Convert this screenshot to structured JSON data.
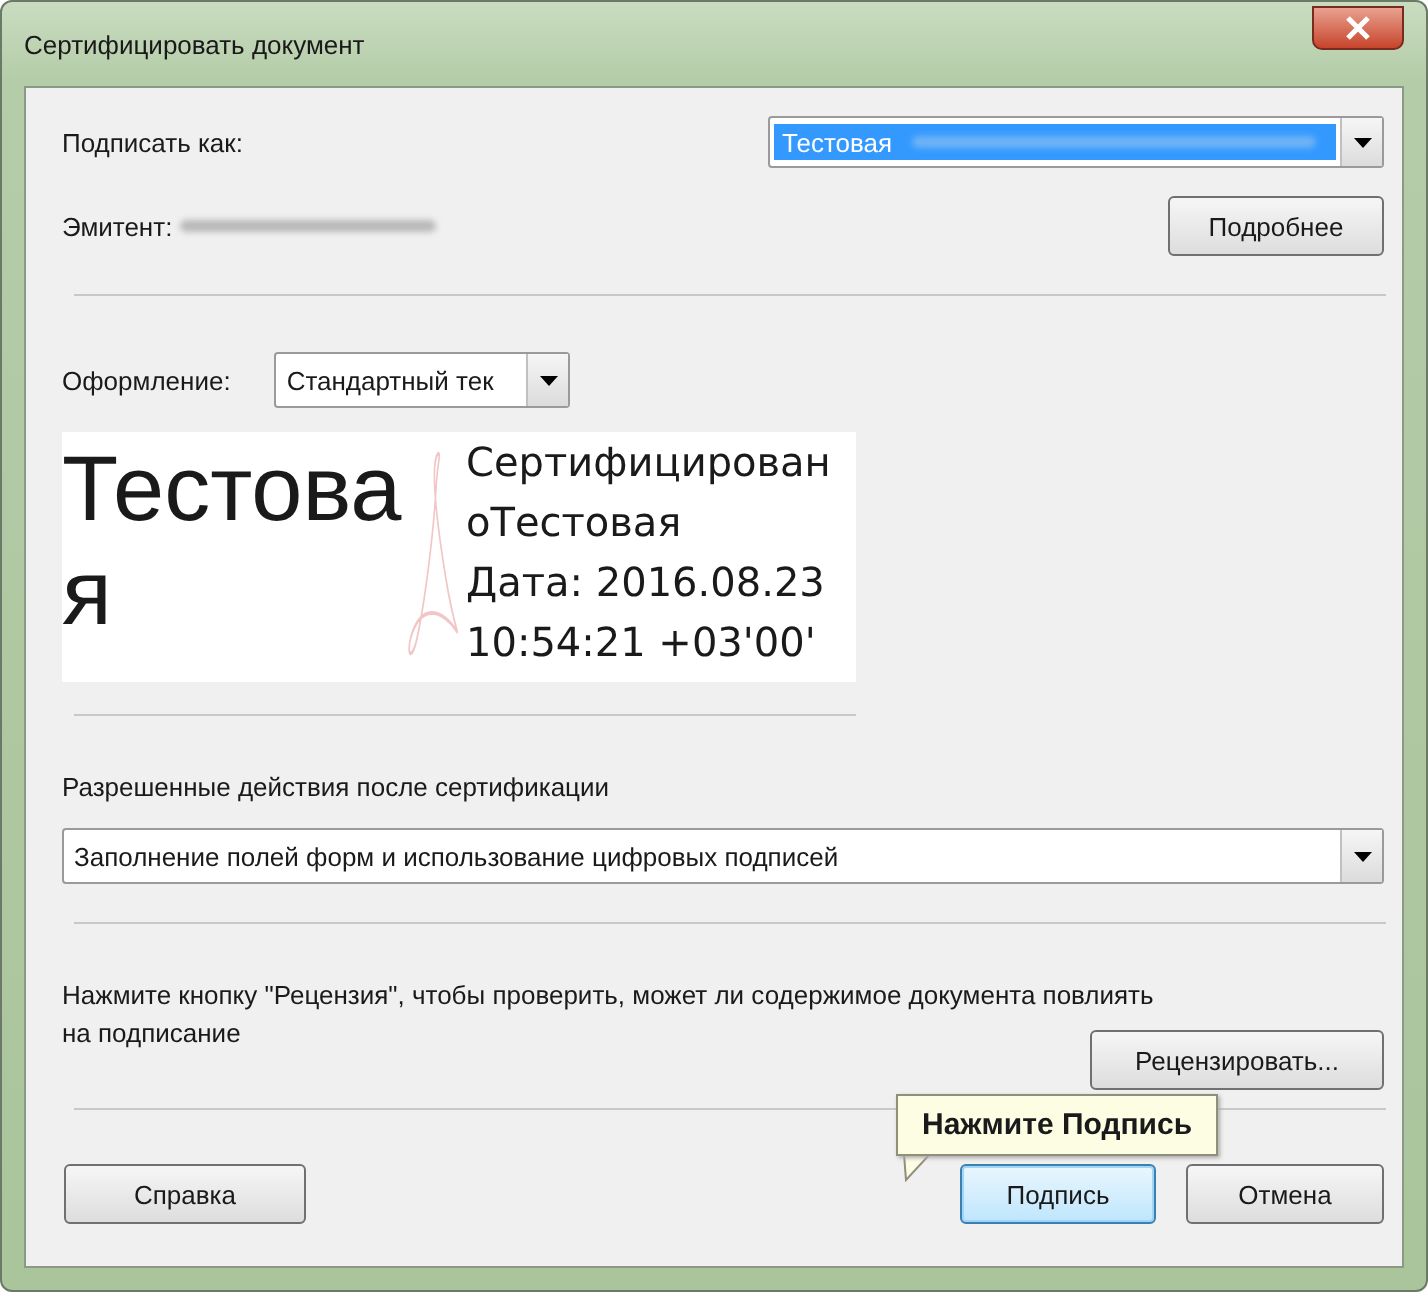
{
  "window": {
    "title": "Сертифицировать документ"
  },
  "sign_as": {
    "label": "Подписать как:",
    "value": "Тестовая"
  },
  "issuer": {
    "label": "Эмитент:"
  },
  "details_button": "Подробнее",
  "appearance": {
    "label": "Оформление:",
    "value": "Стандартный тек"
  },
  "preview": {
    "name_lines": [
      "Тестова",
      "я"
    ],
    "detail_lines": [
      "Сертифицирован",
      "оТестовая",
      "Дата: 2016.08.23",
      "10:54:21 +03'00'"
    ]
  },
  "permitted": {
    "label": "Разрешенные действия после сертификации",
    "value": "Заполнение полей форм и использование цифровых подписей"
  },
  "review": {
    "text": "Нажмите кнопку \"Рецензия\", чтобы проверить, может ли содержимое документа повлиять на подписание",
    "button": "Рецензировать..."
  },
  "tooltip": "Нажмите Подпись",
  "buttons": [
    {
      "label": "Справка",
      "selected": false
    },
    {
      "label": "Подпись",
      "selected": true
    },
    {
      "label": "Отмена",
      "selected": false
    }
  ]
}
